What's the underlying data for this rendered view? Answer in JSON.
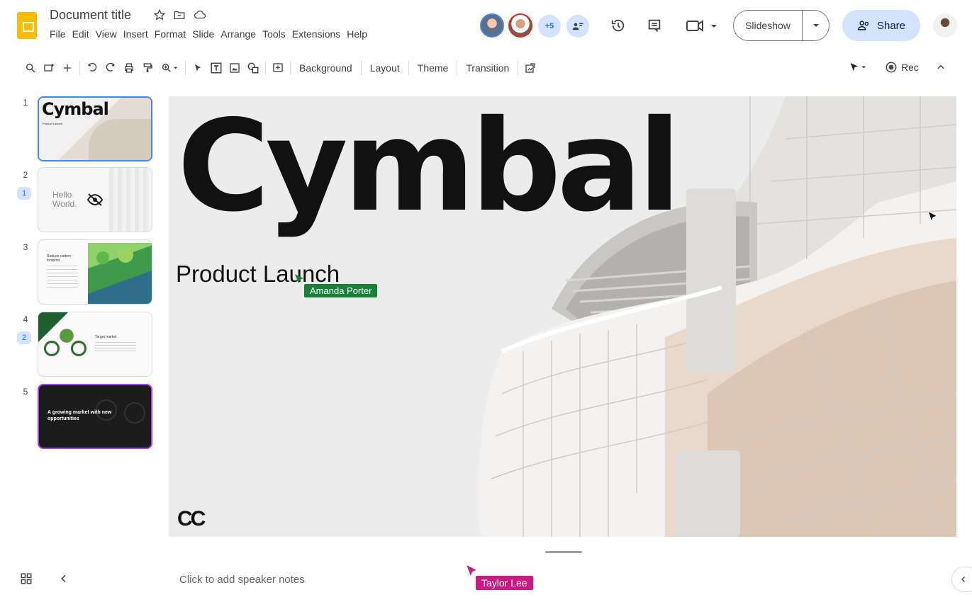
{
  "header": {
    "doc_title": "Document title",
    "menu": [
      "File",
      "Edit",
      "View",
      "Insert",
      "Format",
      "Slide",
      "Arrange",
      "Tools",
      "Extensions",
      "Help"
    ],
    "collaborators_more": "+5",
    "slideshow_label": "Slideshow",
    "share_label": "Share"
  },
  "toolbar": {
    "background_label": "Background",
    "layout_label": "Layout",
    "theme_label": "Theme",
    "transition_label": "Transition",
    "rec_label": "Rec"
  },
  "filmstrip": {
    "slides": [
      {
        "number": "1",
        "title": "Cymbal",
        "subtitle": "Product Launch"
      },
      {
        "number": "2",
        "comment_count": "1",
        "text": "Hello World."
      },
      {
        "number": "3",
        "text": "Reduce carbon footprint"
      },
      {
        "number": "4",
        "comment_count": "2",
        "text": "Target market"
      },
      {
        "number": "5",
        "text": "A growing market with new opportunities"
      }
    ]
  },
  "slide": {
    "title": "Cymbal",
    "subtitle": "Product Launch",
    "logo": "CC"
  },
  "cursors": {
    "amanda": {
      "name": "Amanda Porter",
      "color": "#188038"
    },
    "taylor": {
      "name": "Taylor Lee",
      "color": "#d01884"
    }
  },
  "notes": {
    "placeholder": "Click to add speaker notes"
  }
}
